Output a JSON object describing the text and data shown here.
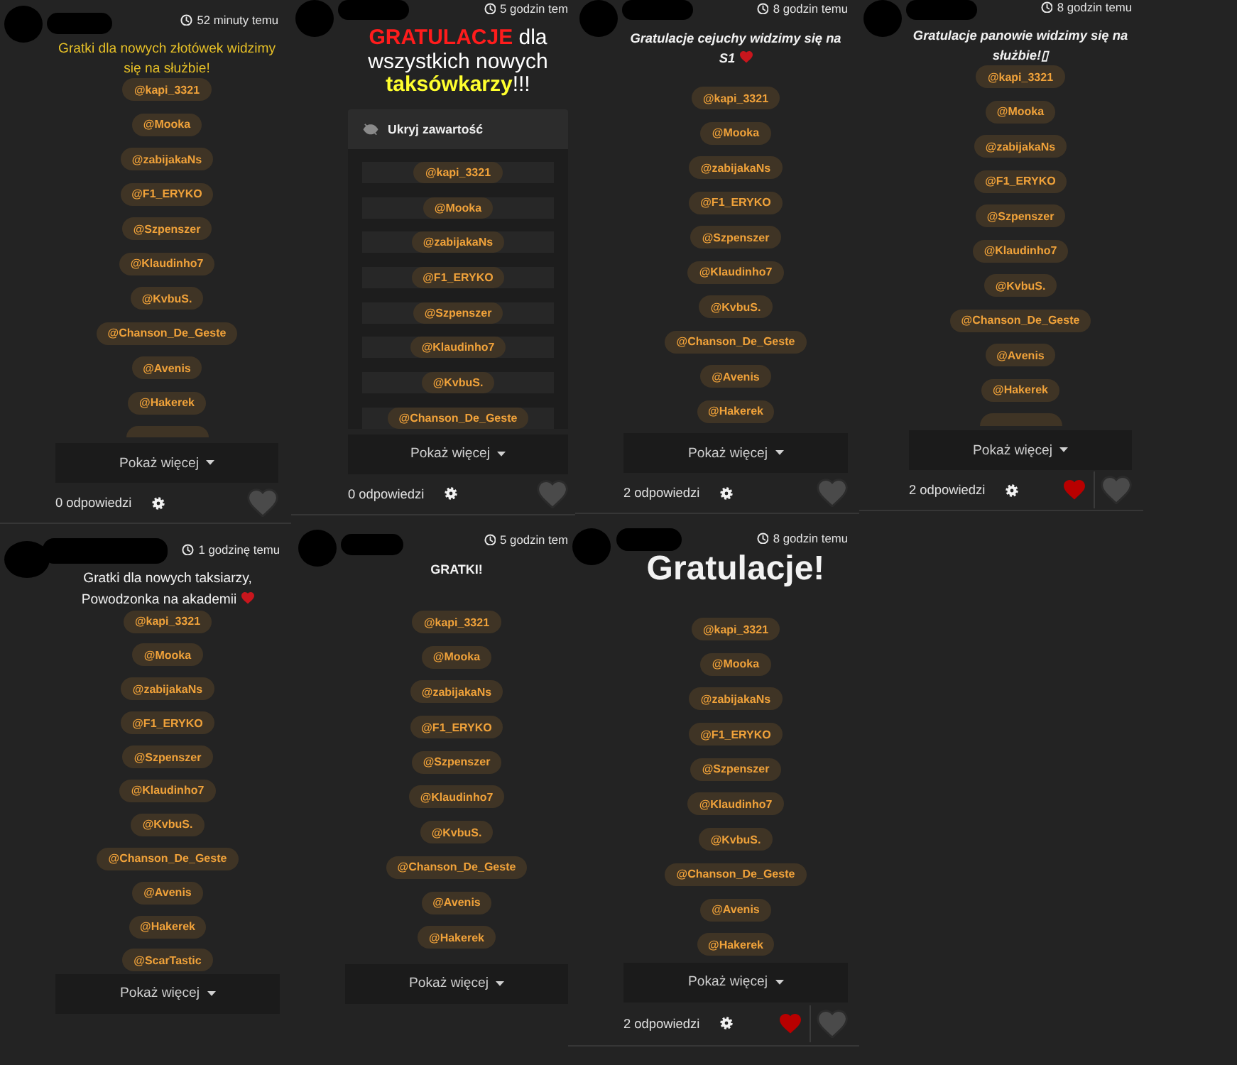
{
  "posts": [
    {
      "timestamp": "52 minuty temu",
      "message": {
        "kind": "highlight",
        "text": "Gratki dla nowych złotówek widzimy się na służbie!",
        "emoji": false
      },
      "mentions": [
        "@kapi_3321",
        "@Mooka",
        "@zabijakaNs",
        "@F1_ERYKO",
        "@Szpenszer",
        "@Klaudinho7",
        "@KvbuS.",
        "@Chanson_De_Geste",
        "@Avenis",
        "@Hakerek"
      ],
      "more_below": true,
      "show_more": "Pokaż więcej",
      "footer": {
        "replies": "0 odpowiedzi",
        "reacted": false
      }
    },
    {
      "timestamp": "5 godzin tem",
      "message": {
        "kind": "segments",
        "segments": [
          {
            "text": "GRATULACJE",
            "bold": true,
            "color": "#ff1c1c"
          },
          {
            "text": " dla wszystkich nowych ",
            "bold": false,
            "color": "#ffffff"
          },
          {
            "text": "taksówkarzy",
            "bold": true,
            "color": "#ffff2e"
          },
          {
            "text": "!!!",
            "bold": false,
            "color": "#ffffff"
          }
        ]
      },
      "spoiler": {
        "label": "Ukryj zawartość",
        "expanded": true
      },
      "mentions": [
        "@kapi_3321",
        "@Mooka",
        "@zabijakaNs",
        "@F1_ERYKO",
        "@Szpenszer",
        "@Klaudinho7",
        "@KvbuS.",
        "@Chanson_De_Geste"
      ],
      "more_below": false,
      "show_more": "Pokaż więcej",
      "footer": {
        "replies": "0 odpowiedzi",
        "reacted": false
      }
    },
    {
      "timestamp": "8 godzin temu",
      "message": {
        "kind": "emphasis",
        "text": "Gratulacje cejuchy widzimy się na S1",
        "emoji": true
      },
      "mentions": [
        "@kapi_3321",
        "@Mooka",
        "@zabijakaNs",
        "@F1_ERYKO",
        "@Szpenszer",
        "@Klaudinho7",
        "@KvbuS.",
        "@Chanson_De_Geste",
        "@Avenis",
        "@Hakerek"
      ],
      "more_below": false,
      "show_more": "Pokaż więcej",
      "footer": {
        "replies": "2 odpowiedzi",
        "reacted": false
      }
    },
    {
      "timestamp": "8 godzin temu",
      "message": {
        "kind": "emphasis",
        "text": "Gratulacje panowie widzimy się na służbie!▯",
        "emoji": false
      },
      "mentions": [
        "@kapi_3321",
        "@Mooka",
        "@zabijakaNs",
        "@F1_ERYKO",
        "@Szpenszer",
        "@Klaudinho7",
        "@KvbuS.",
        "@Chanson_De_Geste",
        "@Avenis",
        "@Hakerek"
      ],
      "more_below": true,
      "show_more": "Pokaż więcej",
      "footer": {
        "replies": "2 odpowiedzi",
        "reacted": true
      }
    },
    {
      "timestamp": "1 godzinę temu",
      "message": {
        "kind": "plain",
        "text": "Gratki dla nowych taksiarzy,\nPowodzonka na akademii",
        "emoji": true
      },
      "mentions": [
        "@kapi_3321",
        "@Mooka",
        "@zabijakaNs",
        "@F1_ERYKO",
        "@Szpenszer",
        "@Klaudinho7",
        "@KvbuS.",
        "@Chanson_De_Geste",
        "@Avenis",
        "@Hakerek",
        "@ScarTastic"
      ],
      "more_below": false,
      "show_more": "Pokaż więcej"
    },
    {
      "timestamp": "5 godzin tem",
      "message": {
        "kind": "strong",
        "text": "GRATKI!",
        "emoji": false
      },
      "mentions": [
        "@kapi_3321",
        "@Mooka",
        "@zabijakaNs",
        "@F1_ERYKO",
        "@Szpenszer",
        "@Klaudinho7",
        "@KvbuS.",
        "@Chanson_De_Geste",
        "@Avenis",
        "@Hakerek"
      ],
      "more_below": false,
      "show_more": "Pokaż więcej"
    },
    {
      "timestamp": "8 godzin temu",
      "message": {
        "kind": "headline",
        "text": "Gratulacje!",
        "emoji": false
      },
      "mentions": [
        "@kapi_3321",
        "@Mooka",
        "@zabijakaNs",
        "@F1_ERYKO",
        "@Szpenszer",
        "@Klaudinho7",
        "@KvbuS.",
        "@Chanson_De_Geste",
        "@Avenis",
        "@Hakerek"
      ],
      "more_below": false,
      "show_more": "Pokaż więcej",
      "footer": {
        "replies": "2 odpowiedzi",
        "reacted": true
      }
    }
  ]
}
